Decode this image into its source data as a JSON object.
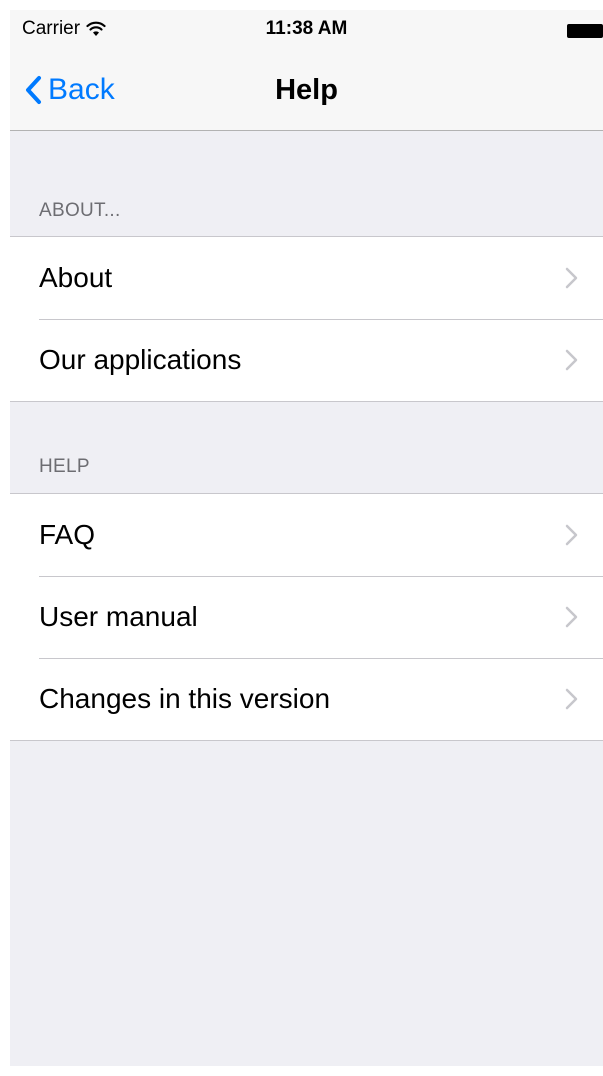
{
  "status_bar": {
    "carrier": "Carrier",
    "time": "11:38 AM"
  },
  "nav": {
    "back_label": "Back",
    "title": "Help"
  },
  "sections": [
    {
      "header": "ABOUT...",
      "rows": [
        {
          "label": "About"
        },
        {
          "label": "Our applications"
        }
      ]
    },
    {
      "header": "HELP",
      "rows": [
        {
          "label": "FAQ"
        },
        {
          "label": "User manual"
        },
        {
          "label": "Changes in this version"
        }
      ]
    }
  ],
  "colors": {
    "accent": "#007aff",
    "background": "#efeff4",
    "separator": "#c8c7cc",
    "header_text": "#6d6d72",
    "chevron": "#c7c7cc"
  },
  "icons": {
    "wifi": "wifi-icon",
    "battery": "battery-icon",
    "back": "chevron-left-icon",
    "disclosure": "chevron-right-icon"
  }
}
